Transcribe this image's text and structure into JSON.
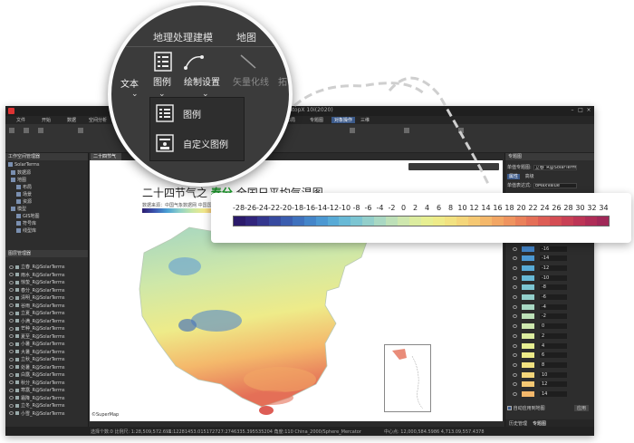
{
  "app": {
    "title": "iDesktopX 10i(2020)",
    "menus": [
      "文件",
      "开始",
      "数据",
      "空间分析",
      "地图",
      "三维",
      "对象操作",
      "在线",
      "专题图",
      "其他",
      "布局",
      "视图",
      "帮助"
    ],
    "active_menu": "对象操作"
  },
  "zoom_ribbon": {
    "tabs": [
      "地理处理建模",
      "地图"
    ],
    "buttons": [
      "文本",
      "图例",
      "绘制设置",
      "矢量化线",
      "拓"
    ],
    "dropdown_items": [
      "图例",
      "自定义图例"
    ]
  },
  "left_panel": {
    "workspace_header": "工作空间管理器",
    "tree": [
      "SolarTerms",
      "数据源",
      "地图",
      "布局",
      "场景",
      "资源",
      "模型",
      "GIS地图",
      "符号库",
      "线型库"
    ],
    "layer_header": "图层管理器",
    "layers": [
      "立春_R@SolarTerms",
      "雨水_R@SolarTerms",
      "惊蛰_R@SolarTerms",
      "春分_R@SolarTerms",
      "清明_R@SolarTerms",
      "谷雨_R@SolarTerms",
      "立夏_R@SolarTerms",
      "小满_R@SolarTerms",
      "芒种_R@SolarTerms",
      "夏至_R@SolarTerms",
      "小暑_R@SolarTerms",
      "大暑_R@SolarTerms",
      "立秋_R@SolarTerms",
      "处暑_R@SolarTerms",
      "白露_R@SolarTerms",
      "秋分_R@SolarTerms",
      "寒露_R@SolarTerms",
      "霜降_R@SolarTerms",
      "立冬_R@SolarTerms",
      "小雪_R@SolarTerms"
    ]
  },
  "document": {
    "tab_label": "二十四节气",
    "title_prefix": "二十四节气之",
    "title_highlight": "春分",
    "title_suffix": "全国日平均气温图",
    "source_text": "数据来源：中国气象数据网 中国国家",
    "copyright": "©SuperMap"
  },
  "legend": {
    "labels": [
      "-28",
      "-26",
      "-24",
      "-22",
      "-20",
      "-18",
      "-16",
      "-14",
      "-12",
      "-10",
      "-8",
      "-6",
      "-4",
      "-2",
      "0",
      "2",
      "4",
      "6",
      "8",
      "10",
      "12",
      "14",
      "16",
      "18",
      "20",
      "22",
      "24",
      "26",
      "28",
      "30",
      "32",
      "34"
    ],
    "colors": [
      "#2b1a6b",
      "#31257c",
      "#34378e",
      "#374a9f",
      "#3b5daf",
      "#3f71bd",
      "#4485c9",
      "#4c98d2",
      "#58aad6",
      "#68b9d6",
      "#7cc5d2",
      "#93cfcb",
      "#a9d8c3",
      "#bde0b8",
      "#cee7ae",
      "#dcec9f",
      "#e7ef92",
      "#eeeb89",
      "#f2e281",
      "#f4d67a",
      "#f5c873",
      "#f4b86b",
      "#f2a664",
      "#ef945f",
      "#ea815a",
      "#e46f57",
      "#dd5d55",
      "#d44d54",
      "#c94055",
      "#bd3556",
      "#af2d57",
      "#a02858"
    ]
  },
  "right_panel": {
    "header": "专题图",
    "field1_label": "单值专题图:",
    "field1_value": "立春_R@SolarTerms#1",
    "tabs": [
      "属性",
      "高级"
    ],
    "field2_label": "单值表达式:",
    "field2_value": "dMaxValue",
    "rows": [
      "-26",
      "-24",
      "-22",
      "-20",
      "-18",
      "-16",
      "-14",
      "-12",
      "-10",
      "-8",
      "-6",
      "-4",
      "-2",
      "0",
      "2",
      "4",
      "6",
      "8",
      "10",
      "12",
      "14"
    ],
    "row_colors": [
      "#31257c",
      "#34378e",
      "#374a9f",
      "#3b5daf",
      "#3f71bd",
      "#4485c9",
      "#4c98d2",
      "#58aad6",
      "#68b9d6",
      "#7cc5d2",
      "#93cfcb",
      "#a9d8c3",
      "#bde0b8",
      "#cee7ae",
      "#dcec9f",
      "#e7ef92",
      "#eeeb89",
      "#f2e281",
      "#f4d67a",
      "#f5c873",
      "#f4b86b"
    ],
    "apply_checkbox": "自动应用到地图",
    "apply_button": "应用",
    "bottom_tabs": [
      "历史管理",
      "专题图"
    ]
  },
  "status": {
    "left": "选择个数:0   比例尺: 1:28,509,572.691",
    "coords": "X:12281453.015172727:2746335.395535204  角度:110  China_2000/Sphere_Mercator",
    "right_coords": "中心点:  12,000,584.5986    4,713.09,557.4378"
  }
}
